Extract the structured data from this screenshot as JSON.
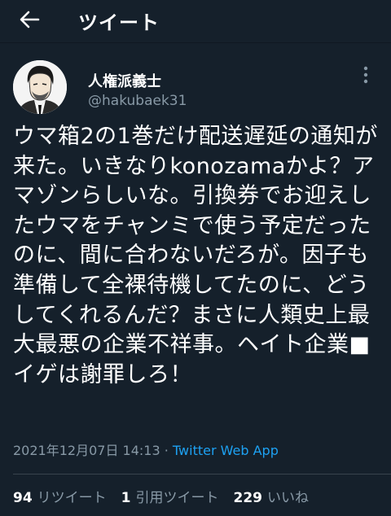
{
  "header": {
    "title": "ツイート",
    "back_icon": "arrow-left-icon"
  },
  "author": {
    "display_name": "人権派義士",
    "handle": "@hakubaek31",
    "avatar_icon": "user-avatar",
    "more_icon": "more-vertical-icon"
  },
  "tweet": {
    "text": "ウマ箱2の1巻だけ配送遅延の通知が来た。いきなりkonozamaかよ？アマゾンらしいな。引換券でお迎えしたウマをチャンミで使う予定だったのに、間に合わないだろが。因子も準備して全裸待機してたのに、どうしてくれるんだ？まさに人類史上最大最悪の企業不祥事。ヘイト企業■イゲは謝罪しろ！",
    "timestamp": "2021年12月07日 14:13",
    "separator": " · ",
    "source": "Twitter Web App"
  },
  "stats": {
    "retweets_count": "94",
    "retweets_label": "リツイート",
    "quotes_count": "1",
    "quotes_label": "引用ツイート",
    "likes_count": "229",
    "likes_label": "いいね"
  },
  "colors": {
    "background": "#15202b",
    "text": "#ffffff",
    "muted": "#8899a6",
    "link": "#1da1f2"
  }
}
